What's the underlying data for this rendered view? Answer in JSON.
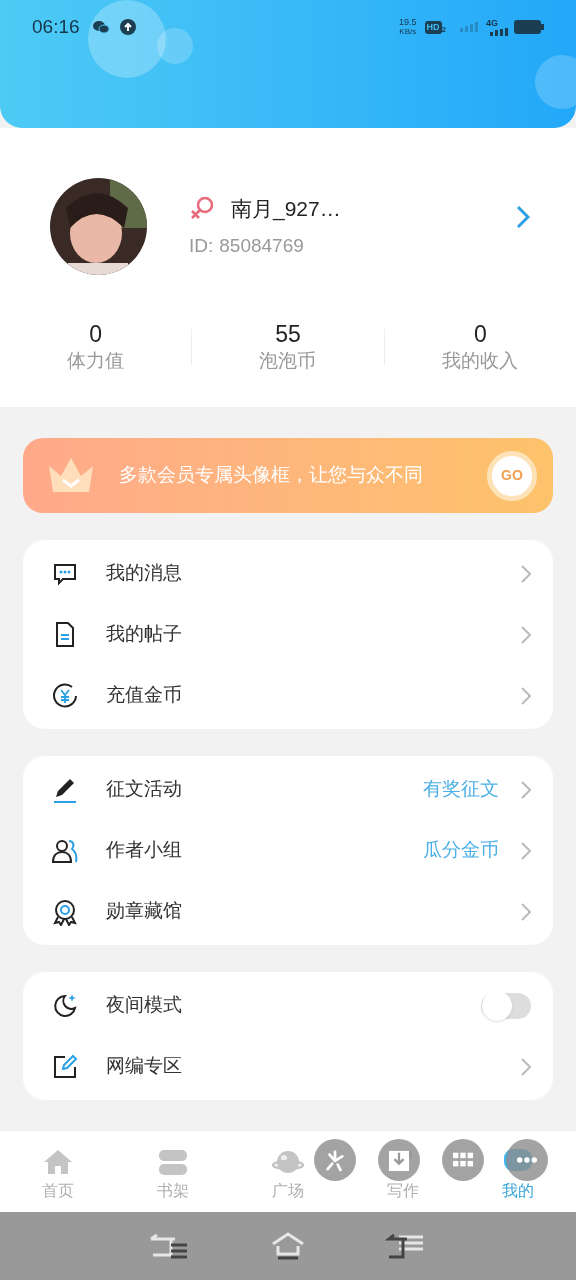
{
  "status_bar": {
    "time": "06:16",
    "speed_value": "19.5",
    "speed_unit": "KB/s",
    "hd_label": "HD",
    "hd_sub": "2",
    "network": "4G"
  },
  "profile": {
    "name": "南月_927…",
    "id_label": "ID:",
    "id_value": "85084769"
  },
  "stats": [
    {
      "value": "0",
      "label": "体力值"
    },
    {
      "value": "55",
      "label": "泡泡币"
    },
    {
      "value": "0",
      "label": "我的收入"
    }
  ],
  "banner": {
    "text": "多款会员专属头像框，让您与众不同",
    "button": "GO"
  },
  "menu_groups": [
    {
      "items": [
        {
          "kind": "link",
          "label": "我的消息"
        },
        {
          "kind": "link",
          "label": "我的帖子"
        },
        {
          "kind": "link",
          "label": "充值金币"
        }
      ]
    },
    {
      "items": [
        {
          "kind": "link",
          "label": "征文活动",
          "hint": "有奖征文"
        },
        {
          "kind": "link",
          "label": "作者小组",
          "hint": "瓜分金币"
        },
        {
          "kind": "link",
          "label": "勋章藏馆"
        }
      ]
    },
    {
      "items": [
        {
          "kind": "toggle",
          "label": "夜间模式",
          "on": false
        },
        {
          "kind": "link",
          "label": "网编专区"
        }
      ]
    }
  ],
  "tabs": [
    {
      "label": "首页",
      "selected": false
    },
    {
      "label": "书架",
      "selected": false
    },
    {
      "label": "广场",
      "selected": false
    },
    {
      "label": "写作",
      "selected": false
    },
    {
      "label": "我的",
      "selected": true
    }
  ]
}
